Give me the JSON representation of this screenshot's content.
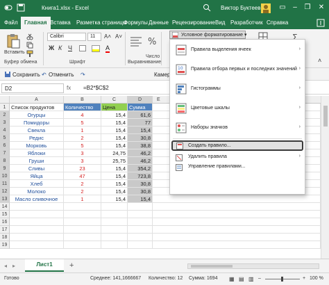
{
  "titlebar": {
    "doc_title": "Книга1.xlsx  -  Excel",
    "user": "Виктор Буктеев",
    "minimize": "–",
    "restore": "❐",
    "close": "✕",
    "color": "#217346"
  },
  "tabs": [
    {
      "label": "Файл"
    },
    {
      "label": "Главная"
    },
    {
      "label": "Вставка"
    },
    {
      "label": "Разметка страницы"
    },
    {
      "label": "Формулы"
    },
    {
      "label": "Данные"
    },
    {
      "label": "Рецензирование"
    },
    {
      "label": "Вид"
    },
    {
      "label": "Разработчик"
    },
    {
      "label": "Справка"
    }
  ],
  "ribbon": {
    "paste_label": "Вставить",
    "clipboard_label": "Буфер обмена",
    "font_name": "Calibri",
    "font_size": "11",
    "font_group_label": "Шрифт",
    "align_label": "Выравнивание",
    "number_label": "Число",
    "cf_button": "Условное форматирование"
  },
  "qbar": {
    "save": "Сохранить",
    "undo": "Отменить",
    "camera": "Камера"
  },
  "formula_bar": {
    "name_box": "D2",
    "fx": "fx",
    "formula": "=B2*$C$2"
  },
  "sheet": {
    "columns": [
      "A",
      "B",
      "C",
      "D",
      "E"
    ],
    "header": [
      "Список продуктов",
      "Количество",
      "Цена",
      "Сумма"
    ],
    "rows": [
      [
        "Огурцы",
        "4",
        "15,4",
        "61,6"
      ],
      [
        "Помидоры",
        "5",
        "15,4",
        "77"
      ],
      [
        "Свекла",
        "1",
        "15,4",
        "15,4"
      ],
      [
        "Редис",
        "2",
        "15,4",
        "30,8"
      ],
      [
        "Морковь",
        "5",
        "15,4",
        "38,8"
      ],
      [
        "Яблоки",
        "3",
        "24,75",
        "46,2"
      ],
      [
        "Груши",
        "3",
        "25,75",
        "46,2"
      ],
      [
        "Сливы",
        "23",
        "15,4",
        "354,2"
      ],
      [
        "Яйца",
        "47",
        "15,4",
        "723,8"
      ],
      [
        "Хлеб",
        "2",
        "15,4",
        "30,8"
      ],
      [
        "Молоко",
        "2",
        "15,4",
        "30,8"
      ],
      [
        "Масло сливочное",
        "1",
        "15,4",
        "15,4"
      ]
    ],
    "row_numbers": [
      "1",
      "2",
      "3",
      "4",
      "5",
      "6",
      "7",
      "8",
      "9",
      "10",
      "11",
      "12",
      "13",
      "14",
      "15",
      "16",
      "17",
      "18",
      "19"
    ]
  },
  "menu": {
    "items": [
      {
        "label": "Правила выделения ячеек",
        "icon": "highlight-rules-icon"
      },
      {
        "label": "Правила отбора первых и последних значений",
        "icon": "top-bottom-icon"
      },
      {
        "label": "Гистограммы",
        "icon": "data-bars-icon"
      },
      {
        "label": "Цветовые шкалы",
        "icon": "color-scales-icon"
      },
      {
        "label": "Наборы значков",
        "icon": "icon-sets-icon"
      },
      {
        "label": "Создать правило...",
        "icon": "new-rule-icon"
      },
      {
        "label": "Удалить правила",
        "icon": "clear-rules-icon"
      },
      {
        "label": "Управление правилами...",
        "icon": "manage-rules-icon"
      }
    ]
  },
  "sheet_tabs": {
    "active": "Лист1",
    "add": "+"
  },
  "status": {
    "ready": "Готово",
    "average": "Среднее: 141,1666667",
    "count": "Количество: 12",
    "sum": "Сумма: 1694",
    "zoom": "100 %"
  },
  "colors": {
    "name_text": "#1f4e9a",
    "qty_text": "#d42020",
    "selection": "#c9c9c9",
    "header_green": "#92d050",
    "header_blue": "#4f81bd"
  }
}
